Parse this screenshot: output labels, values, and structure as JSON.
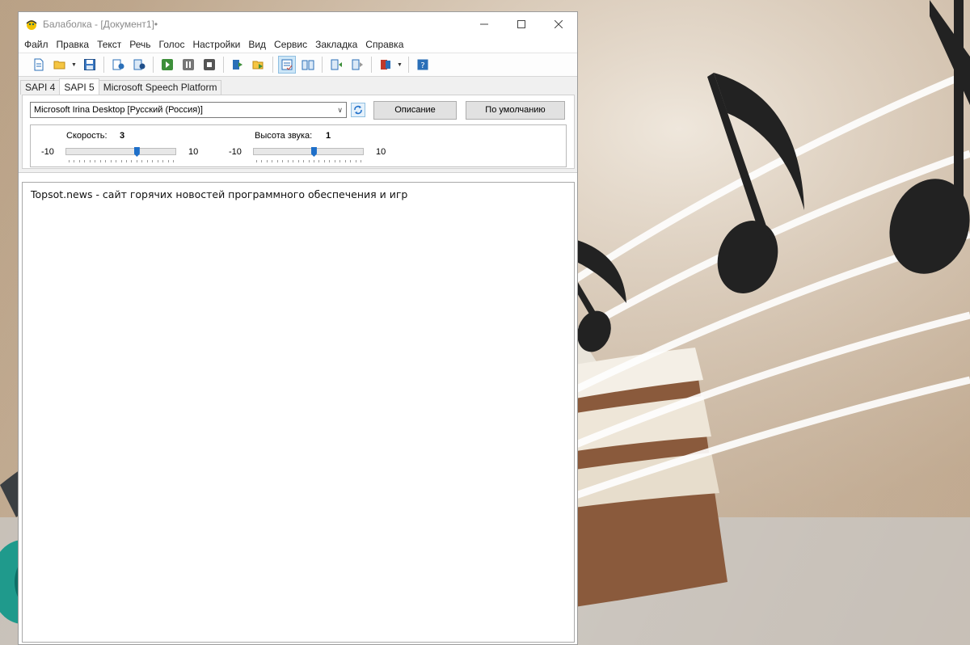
{
  "window": {
    "title": "Балаболка - [Документ1]•"
  },
  "menu": [
    "Файл",
    "Правка",
    "Текст",
    "Речь",
    "Голос",
    "Настройки",
    "Вид",
    "Сервис",
    "Закладка",
    "Справка"
  ],
  "toolbar": {
    "icons": [
      "new-document-icon",
      "open-folder-icon",
      "save-icon",
      "read-clipboard-icon",
      "read-file-icon",
      "play-icon",
      "pause-icon",
      "stop-icon",
      "export-audio-icon",
      "batch-convert-icon",
      "spell-check-icon",
      "read-aloud-icon",
      "previous-icon",
      "next-icon",
      "dictionary-icon",
      "help-icon"
    ]
  },
  "tabs": [
    "SAPI 4",
    "SAPI 5",
    "Microsoft Speech Platform"
  ],
  "active_tab": "SAPI 5",
  "voice": {
    "selected": "Microsoft Irina Desktop [Русский (Россия)]",
    "description_button": "Описание",
    "default_button": "По умолчанию"
  },
  "rate": {
    "label": "Скорость:",
    "value": "3",
    "min": "-10",
    "max": "10",
    "level": 3
  },
  "pitch": {
    "label": "Высота звука:",
    "value": "1",
    "min": "-10",
    "max": "10",
    "level": 1
  },
  "editor": {
    "text": "Topsot.news - сайт горячих новостей программного обеспечения и игр"
  },
  "colors": {
    "accent": "#1e6fc9",
    "smiley_yellow": "#f2c200",
    "headphone_teal": "#1f9a8c"
  }
}
